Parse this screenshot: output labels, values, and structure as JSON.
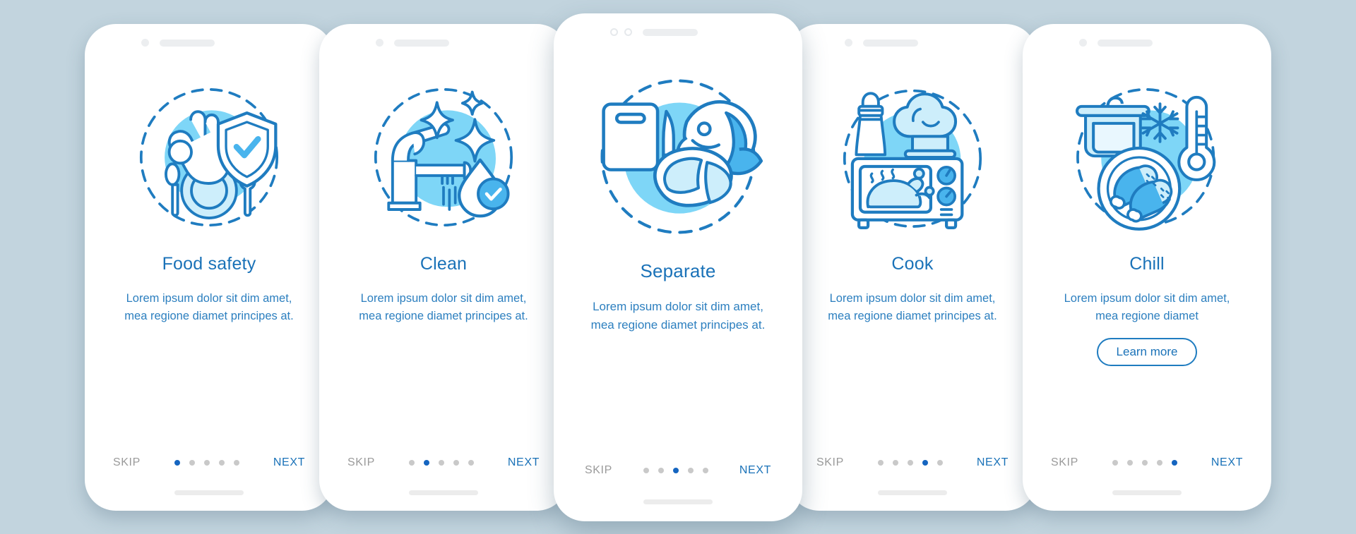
{
  "background_color": "#c2d4de",
  "accent_color": "#1a72b8",
  "illustration_circle_color": "#7ed6f7",
  "screens": [
    {
      "title": "Food safety",
      "description": "Lorem ipsum dolor sit dim amet, mea regione diamet principes at.",
      "skip_label": "SKIP",
      "next_label": "NEXT",
      "active_dot": 1,
      "dot_count": 5,
      "illustration": "ok-hand-shield-plate-icon",
      "has_learn_more": false
    },
    {
      "title": "Clean",
      "description": "Lorem ipsum dolor sit dim amet, mea regione diamet principes at.",
      "skip_label": "SKIP",
      "next_label": "NEXT",
      "active_dot": 2,
      "dot_count": 5,
      "illustration": "faucet-water-drop-sparkle-icon",
      "has_learn_more": false
    },
    {
      "title": "Separate",
      "description": "Lorem ipsum dolor sit dim amet, mea regione diamet principes at.",
      "skip_label": "SKIP",
      "next_label": "NEXT",
      "active_dot": 3,
      "dot_count": 5,
      "illustration": "cutting-board-knife-fish-icon",
      "has_learn_more": false
    },
    {
      "title": "Cook",
      "description": "Lorem ipsum dolor sit dim amet, mea regione diamet principes at.",
      "skip_label": "SKIP",
      "next_label": "NEXT",
      "active_dot": 4,
      "dot_count": 5,
      "illustration": "oven-chicken-chef-hat-salt-icon",
      "has_learn_more": false
    },
    {
      "title": "Chill",
      "description": "Lorem ipsum dolor sit dim amet, mea regione diamet",
      "learn_more_label": "Learn more",
      "skip_label": "SKIP",
      "next_label": "NEXT",
      "active_dot": 5,
      "dot_count": 5,
      "illustration": "pot-snowflake-thermometer-chicken-icon",
      "has_learn_more": true
    }
  ]
}
